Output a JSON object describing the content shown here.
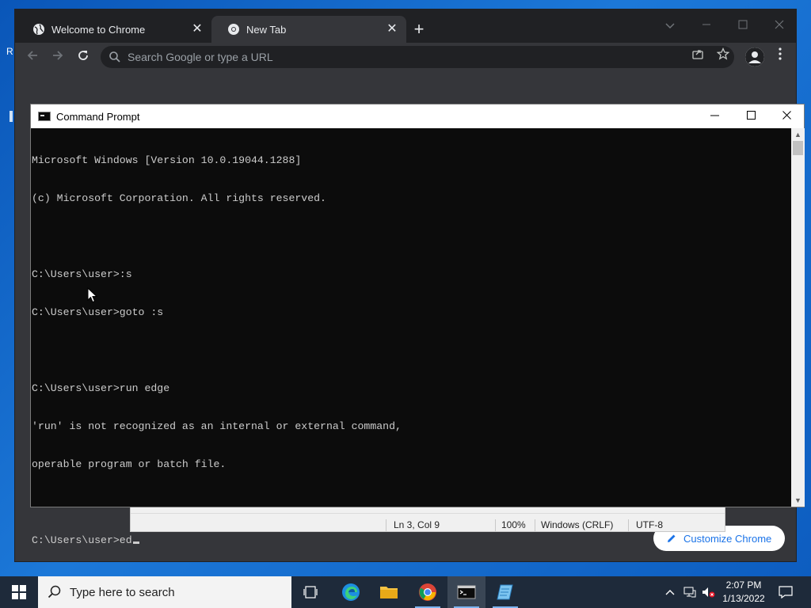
{
  "desktop": {
    "peek_letter": "R"
  },
  "chrome": {
    "tabs": [
      {
        "label": "Welcome to Chrome",
        "close": "✕"
      },
      {
        "label": "New Tab",
        "close": "✕"
      }
    ],
    "new_tab": "+",
    "omnibox_placeholder": "Search Google or type a URL",
    "customize_label": "Customize Chrome"
  },
  "notepad": {
    "status": {
      "position": "Ln 3, Col 9",
      "zoom": "100%",
      "line_endings": "Windows (CRLF)",
      "encoding": "UTF-8"
    }
  },
  "cmd": {
    "title": "Command Prompt",
    "lines": [
      "Microsoft Windows [Version 10.0.19044.1288]",
      "(c) Microsoft Corporation. All rights reserved.",
      "",
      "C:\\Users\\user>:s",
      "C:\\Users\\user>goto :s",
      "",
      "C:\\Users\\user>run edge",
      "'run' is not recognized as an internal or external command,",
      "operable program or batch file.",
      "",
      "C:\\Users\\user>ed"
    ]
  },
  "taskbar": {
    "search_placeholder": "Type here to search",
    "time": "2:07 PM",
    "date": "1/13/2022"
  },
  "colors": {
    "chrome_dark": "#202124",
    "chrome_surface": "#35363a",
    "cmd_bg": "#0c0c0c",
    "cmd_text": "#cccccc",
    "accent_blue": "#1a73e8",
    "taskbar": "#1e2a3a"
  }
}
